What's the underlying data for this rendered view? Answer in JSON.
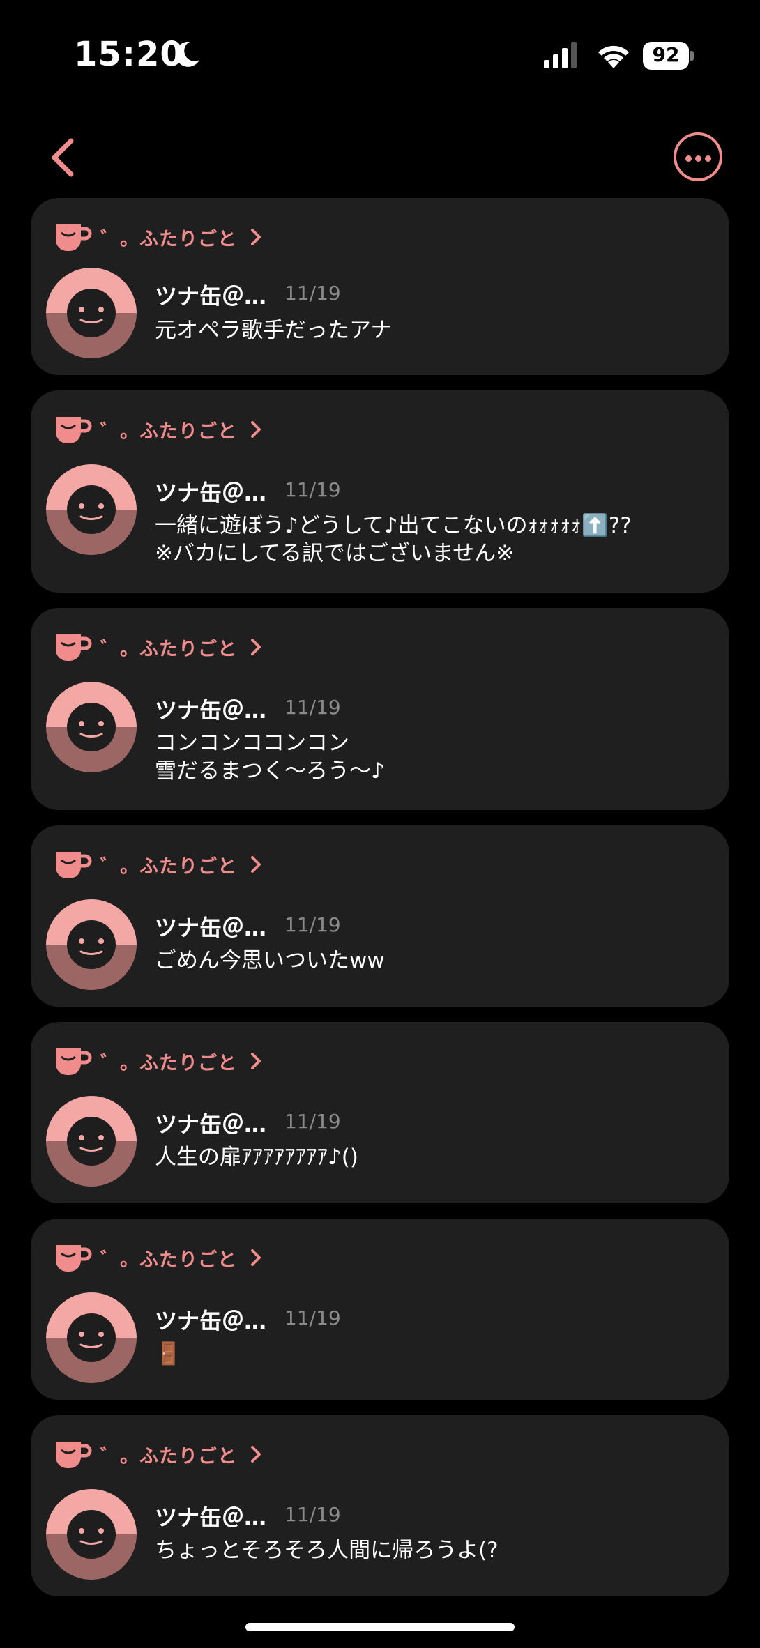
{
  "status_bar": {
    "time": "15:20",
    "battery": "92"
  },
  "colors": {
    "accent": "#f08c8c",
    "card": "#1f1f1f",
    "background": "#000000"
  },
  "cards": [
    {
      "group": "゛。ふたりごと",
      "name": "ツナ缶＠…",
      "date": "11/19",
      "message": "元オペラ歌手だったアナ"
    },
    {
      "group": "゛。ふたりごと",
      "name": "ツナ缶＠…",
      "date": "11/19",
      "message": "一緒に遊ぼう♪どうして♪出てこないのｫｫｫｫｫ⬆️??\n※バカにしてる訳ではございません※"
    },
    {
      "group": "゛。ふたりごと",
      "name": "ツナ缶＠…",
      "date": "11/19",
      "message": "コンコンココンコン\n雪だるまつく〜ろう〜♪"
    },
    {
      "group": "゛。ふたりごと",
      "name": "ツナ缶＠…",
      "date": "11/19",
      "message": "ごめん今思いついたww"
    },
    {
      "group": "゛。ふたりごと",
      "name": "ツナ缶＠…",
      "date": "11/19",
      "message": "人生の扉ｱｱｱｱｱｱｱｱ♪()"
    },
    {
      "group": "゛。ふたりごと",
      "name": "ツナ缶＠…",
      "date": "11/19",
      "message": "🚪"
    },
    {
      "group": "゛。ふたりごと",
      "name": "ツナ缶＠…",
      "date": "11/19",
      "message": "ちょっとそろそろ人間に帰ろうよ(?"
    }
  ]
}
